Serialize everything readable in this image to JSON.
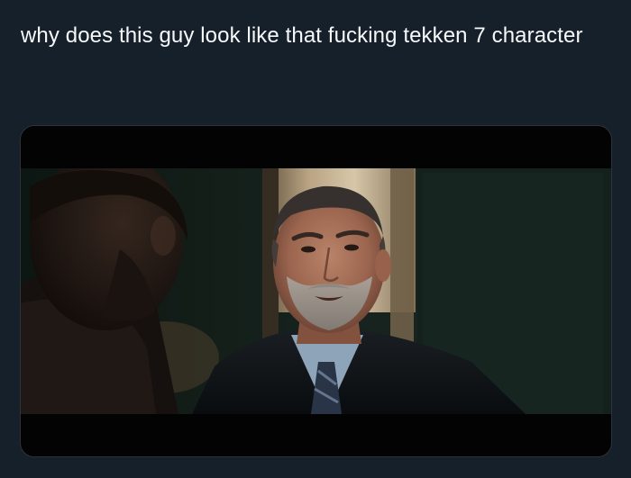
{
  "tweet": {
    "text": "why does this guy look like that fucking tekken 7 character",
    "background_color": "#15202b",
    "text_color": "#f7f9f9"
  },
  "media": {
    "type": "image",
    "letterbox_color": "#030303"
  }
}
